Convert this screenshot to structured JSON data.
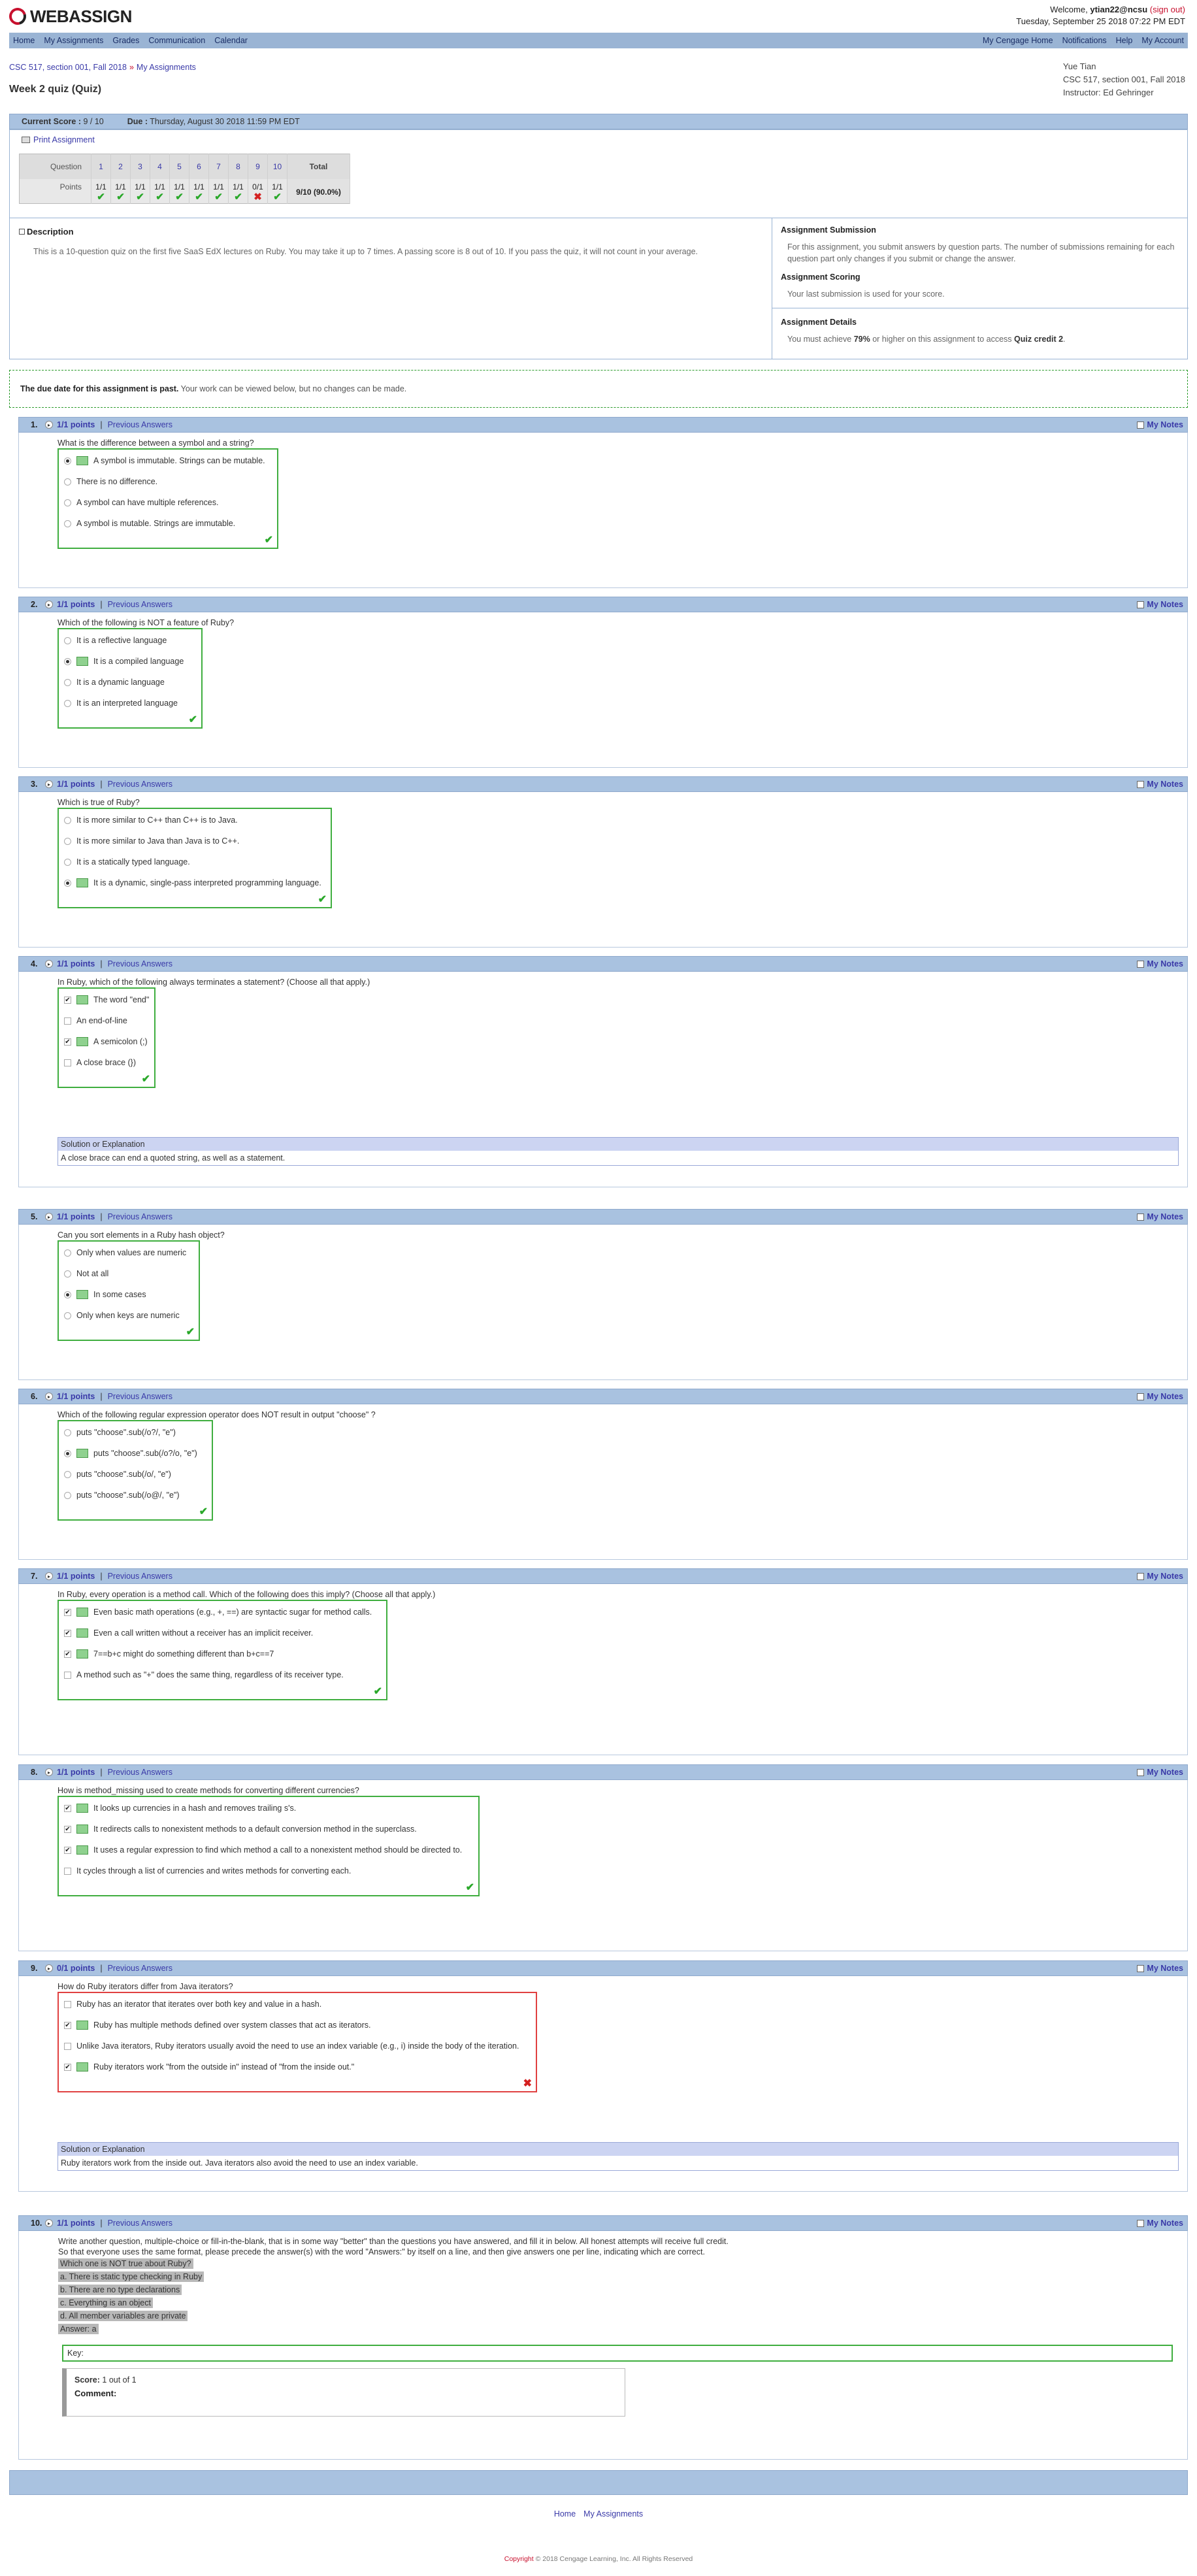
{
  "header": {
    "logo_prefix": "WEB",
    "logo_suffix": "ASSIGN",
    "welcome_label": "Welcome,",
    "user": "ytian22@ncsu",
    "signout": "(sign out)",
    "datetime": "Tuesday, September 25 2018 07:22 PM EDT"
  },
  "nav": {
    "left": [
      "Home",
      "My Assignments",
      "Grades",
      "Communication",
      "Calendar"
    ],
    "right": [
      "My Cengage Home",
      "Notifications",
      "Help",
      "My Account"
    ]
  },
  "breadcrumb": {
    "course": "CSC 517, section 001, Fall 2018",
    "sep": "»",
    "assignments": "My Assignments"
  },
  "page_title": "Week 2 quiz (Quiz)",
  "userinfo": {
    "name": "Yue Tian",
    "course": "CSC 517, section 001, Fall 2018",
    "instructor": "Instructor: Ed Gehringer"
  },
  "scorebar": {
    "score_label": "Current Score :",
    "score": "9 / 10",
    "due_label": "Due :",
    "due": "Thursday, August 30 2018 11:59 PM EDT"
  },
  "print": "Print Assignment",
  "score_grid": {
    "question_label": "Question",
    "points_label": "Points",
    "total_label": "Total",
    "questions": [
      "1",
      "2",
      "3",
      "4",
      "5",
      "6",
      "7",
      "8",
      "9",
      "10"
    ],
    "points": [
      "1/1",
      "1/1",
      "1/1",
      "1/1",
      "1/1",
      "1/1",
      "1/1",
      "1/1",
      "0/1",
      "1/1"
    ],
    "correct": [
      true,
      true,
      true,
      true,
      true,
      true,
      true,
      true,
      false,
      true
    ],
    "total": "9/10 (90.0%)"
  },
  "description": {
    "title": "Description",
    "text": "This is a 10-question quiz on the first five SaaS EdX lectures on Ruby. You may take it up to 7 times. A passing score is 8 out of 10. If you pass the quiz, it will not count in your average."
  },
  "side": {
    "submission_title": "Assignment Submission",
    "submission_text": "For this assignment, you submit answers by question parts. The number of submissions remaining for each question part only changes if you submit or change the answer.",
    "scoring_title": "Assignment Scoring",
    "scoring_text": "Your last submission is used for your score.",
    "details_title": "Assignment Details",
    "details_pre": "You must achieve",
    "details_pct": "79%",
    "details_mid": "or higher on this assignment to access",
    "details_link": "Quiz credit 2",
    "details_end": "."
  },
  "notice": {
    "bold": "The due date for this assignment is past.",
    "text": "Your work can be viewed below, but no changes can be made."
  },
  "labels": {
    "prev": "Previous Answers",
    "notes": "My Notes",
    "solution": "Solution or Explanation",
    "correct_mark": "✔",
    "wrong_mark": "✖"
  },
  "questions": [
    {
      "num": "1.",
      "points": "1/1 points",
      "type": "radio",
      "correct": true,
      "text": "What is the difference between a symbol and a string?",
      "options": [
        {
          "text": "A symbol is immutable. Strings can be mutable.",
          "selected": true
        },
        {
          "text": "There is no difference.",
          "selected": false
        },
        {
          "text": "A symbol can have multiple references.",
          "selected": false
        },
        {
          "text": "A symbol is mutable. Strings are immutable.",
          "selected": false
        }
      ]
    },
    {
      "num": "2.",
      "points": "1/1 points",
      "type": "radio",
      "correct": true,
      "text": "Which of the following is NOT a feature of Ruby?",
      "options": [
        {
          "text": "It is a reflective language",
          "selected": false
        },
        {
          "text": "It is a compiled language",
          "selected": true
        },
        {
          "text": "It is a dynamic language",
          "selected": false
        },
        {
          "text": "It is an interpreted language",
          "selected": false
        }
      ]
    },
    {
      "num": "3.",
      "points": "1/1 points",
      "type": "radio",
      "correct": true,
      "text": "Which is true of Ruby?",
      "options": [
        {
          "text": "It is more similar to C++ than C++ is to Java.",
          "selected": false
        },
        {
          "text": "It is more similar to Java than Java is to C++.",
          "selected": false
        },
        {
          "text": "It is a statically typed language.",
          "selected": false
        },
        {
          "text": "It is a dynamic, single-pass interpreted programming language.",
          "selected": true
        }
      ]
    },
    {
      "num": "4.",
      "points": "1/1 points",
      "type": "check",
      "correct": true,
      "text": "In Ruby, which of the following always terminates a statement? (Choose all that apply.)",
      "options": [
        {
          "text": "The word \"end\"",
          "selected": true
        },
        {
          "text": "An end-of-line",
          "selected": false
        },
        {
          "text": "A semicolon (;)",
          "selected": true
        },
        {
          "text": "A close brace (})",
          "selected": false
        }
      ],
      "solution": "A close brace can end a quoted string, as well as a statement."
    },
    {
      "num": "5.",
      "points": "1/1 points",
      "type": "radio",
      "correct": true,
      "text": "Can you sort elements in a Ruby hash object?",
      "options": [
        {
          "text": "Only when values are numeric",
          "selected": false
        },
        {
          "text": "Not at all",
          "selected": false
        },
        {
          "text": "In some cases",
          "selected": true
        },
        {
          "text": "Only when keys are numeric",
          "selected": false
        }
      ]
    },
    {
      "num": "6.",
      "points": "1/1 points",
      "type": "radio",
      "correct": true,
      "text": "Which of the following regular expression operator does NOT result in output \"choose\" ?",
      "options": [
        {
          "text": "puts \"choose\".sub(/o?/, \"e\")",
          "selected": false
        },
        {
          "text": "puts \"choose\".sub(/o?/o, \"e\")",
          "selected": true
        },
        {
          "text": "puts \"choose\".sub(/o/, \"e\")",
          "selected": false
        },
        {
          "text": "puts \"choose\".sub(/o@/, \"e\")",
          "selected": false
        }
      ]
    },
    {
      "num": "7.",
      "points": "1/1 points",
      "type": "check",
      "correct": true,
      "text": "In Ruby, every operation is a method call. Which of the following does this imply? (Choose all that apply.)",
      "options": [
        {
          "text": "Even basic math operations (e.g., +, ==) are syntactic sugar for method calls.",
          "selected": true
        },
        {
          "text": "Even a call written without a receiver has an implicit receiver.",
          "selected": true
        },
        {
          "text": "7==b+c might do something different than b+c==7",
          "selected": true
        },
        {
          "text": "A method such as \"+\" does the same thing, regardless of its receiver type.",
          "selected": false
        }
      ]
    },
    {
      "num": "8.",
      "points": "1/1 points",
      "type": "check",
      "correct": true,
      "text": "How is method_missing used to create methods for converting different currencies?",
      "options": [
        {
          "text": "It looks up currencies in a hash and removes trailing s's.",
          "selected": true
        },
        {
          "text": "It redirects calls to nonexistent methods to a default conversion method in the superclass.",
          "selected": true
        },
        {
          "text": "It uses a regular expression to find which method a call to a nonexistent method should be directed to.",
          "selected": true
        },
        {
          "text": "It cycles through a list of currencies and writes methods for converting each.",
          "selected": false
        }
      ]
    },
    {
      "num": "9.",
      "points": "0/1 points",
      "type": "check",
      "correct": false,
      "text": "How do Ruby iterators differ from Java iterators?",
      "options": [
        {
          "text": "Ruby has an iterator that iterates over both key and value in a hash.",
          "selected": false
        },
        {
          "text": "Ruby has multiple methods defined over system classes that act as iterators.",
          "selected": true
        },
        {
          "text": "Unlike Java iterators, Ruby iterators usually avoid the need to use an index variable (e.g., i) inside the body of the iteration.",
          "selected": false
        },
        {
          "text": "Ruby iterators work \"from the outside in\" instead of \"from the inside out.\"",
          "selected": true
        }
      ],
      "solution": "Ruby iterators work from the inside out. Java iterators also avoid the need to use an index variable."
    }
  ],
  "q10": {
    "num": "10.",
    "points": "1/1 points",
    "line1": "Write another question, multiple-choice or fill-in-the-blank, that is in some way \"better\" than the questions you have answered, and fill it in below. All honest attempts will receive full credit.",
    "line2": "So that everyone uses the same format, please precede the answer(s) with the word \"Answers:\" by itself on a line, and then give answers one per line, indicating which are correct.",
    "answer_lines": [
      "Which one is NOT true about Ruby?",
      "a. There is static type checking in Ruby",
      "b. There are no type declarations",
      "c. Everything is an object",
      "d. All member variables are private",
      "Answer: a"
    ],
    "key_label": "Key:",
    "score_label": "Score:",
    "score_value": "1 out of 1",
    "comment_label": "Comment:"
  },
  "footer": {
    "links": [
      "Home",
      "My Assignments"
    ],
    "copyright_word": "Copyright",
    "copyright_text": "© 2018 Cengage Learning, Inc. All Rights Reserved"
  }
}
